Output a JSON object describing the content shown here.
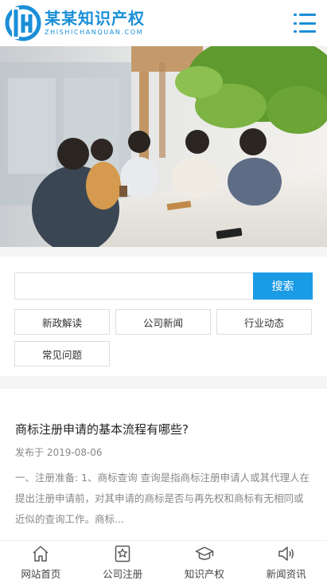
{
  "header": {
    "logo_cn": "某某知识产权",
    "logo_en": "ZHISHICHANQUAN.COM",
    "menu_icon": "hamburger-menu-icon"
  },
  "colors": {
    "brand": "#1a8fd8",
    "search_button": "#1a9be6"
  },
  "search": {
    "placeholder": "",
    "value": "",
    "button_label": "搜索"
  },
  "tags": [
    "新政解读",
    "公司新闻",
    "行业动态",
    "常见问题"
  ],
  "article": {
    "title": "商标注册申请的基本流程有哪些?",
    "date": "发布于 2019-08-06",
    "summary": "一、注册准备: 1、商标查询 查询是指商标注册申请人或其代理人在提出注册申请前，对其申请的商标是否与再先权和商标有无相同或近似的查询工作。商标..."
  },
  "bottom_nav": [
    {
      "label": "网站首页",
      "icon": "home-icon"
    },
    {
      "label": "公司注册",
      "icon": "star-badge-icon"
    },
    {
      "label": "知识产权",
      "icon": "graduation-cap-icon"
    },
    {
      "label": "新闻资讯",
      "icon": "speaker-icon"
    }
  ]
}
